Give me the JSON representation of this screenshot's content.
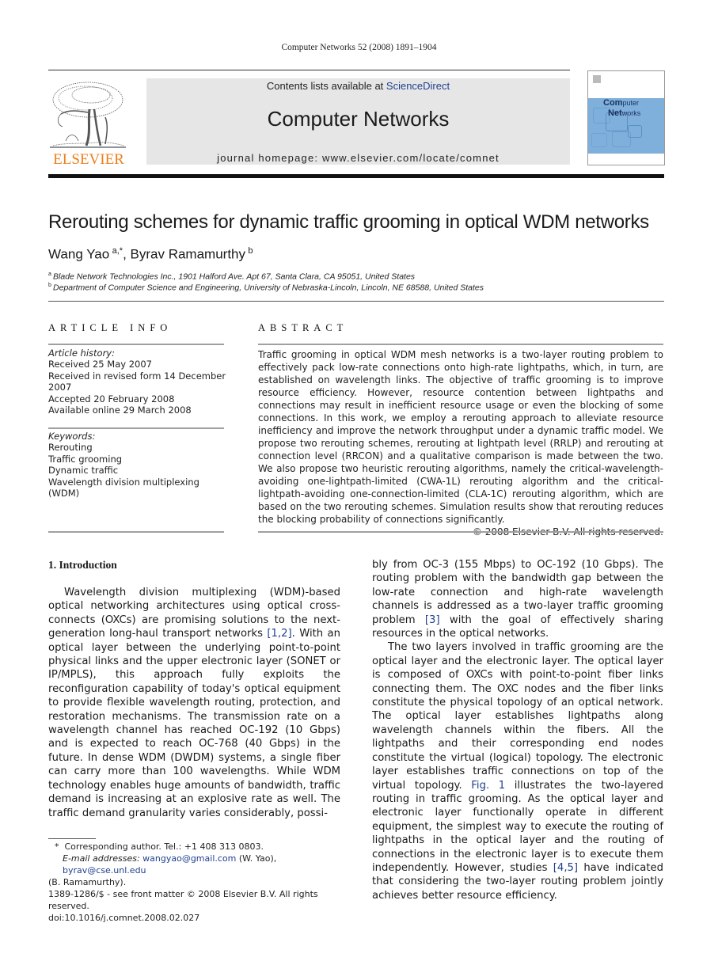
{
  "header": {
    "running_head": "Computer Networks 52 (2008) 1891–1904",
    "contents_prefix": "Contents lists available at ",
    "contents_link": "ScienceDirect",
    "journal_name": "Computer Networks",
    "homepage": "journal homepage: www.elsevier.com/locate/comnet",
    "publisher": "ELSEVIER",
    "cover_title_1a": "Com",
    "cover_title_1b": "puter",
    "cover_title_2a": "Net",
    "cover_title_2b": "works",
    "colors": {
      "publisher_orange": "#f07d19",
      "link_blue": "#1f3f8f",
      "banner_gray": "#e6e6e6",
      "cover_blue": "#7fb0dc"
    }
  },
  "article": {
    "title": "Rerouting schemes for dynamic traffic grooming in optical WDM networks",
    "authors": [
      {
        "name": "Wang Yao",
        "sup": "a,*"
      },
      {
        "name": "Byrav Ramamurthy",
        "sup": "b"
      }
    ],
    "author_sep": ", ",
    "affiliations": [
      {
        "mark": "a",
        "text": "Blade Network Technologies Inc., 1901 Halford Ave. Apt 67, Santa Clara, CA 95051, United States"
      },
      {
        "mark": "b",
        "text": "Department of Computer Science and Engineering, University of Nebraska-Lincoln, Lincoln, NE 68588, United States"
      }
    ]
  },
  "article_info": {
    "heading": "ARTICLE INFO",
    "history_label": "Article history:",
    "history": [
      "Received 25 May 2007",
      "Received in revised form 14 December 2007",
      "Accepted 20 February 2008",
      "Available online 29 March 2008"
    ],
    "keywords_label": "Keywords:",
    "keywords": [
      "Rerouting",
      "Traffic grooming",
      "Dynamic traffic",
      "Wavelength division multiplexing (WDM)"
    ]
  },
  "abstract": {
    "heading": "ABSTRACT",
    "text": "Traffic grooming in optical WDM mesh networks is a two-layer routing problem to effectively pack low-rate connections onto high-rate lightpaths, which, in turn, are established on wavelength links. The objective of traffic grooming is to improve resource efficiency. However, resource contention between lightpaths and connections may result in inefficient resource usage or even the blocking of some connections. In this work, we employ a rerouting approach to alleviate resource inefficiency and improve the network throughput under a dynamic traffic model. We propose two rerouting schemes, rerouting at lightpath level (RRLP) and rerouting at connection level (RRCON) and a qualitative comparison is made between the two. We also propose two heuristic rerouting algorithms, namely the critical-wavelength-avoiding one-lightpath-limited (CWA-1L) rerouting algorithm and the critical-lightpath-avoiding one-connection-limited (CLA-1C) rerouting algorithm, which are based on the two rerouting schemes. Simulation results show that rerouting reduces the blocking probability of connections significantly.",
    "copyright": "© 2008 Elsevier B.V. All rights reserved."
  },
  "intro": {
    "heading": "1.  Introduction",
    "p1_a": "Wavelength division multiplexing (WDM)-based optical networking architectures using optical cross-connects (OXCs) are promising solutions to the next-generation long-haul transport networks ",
    "p1_ref1": "[1,2]",
    "p1_b": ". With an optical layer between the underlying point-to-point physical links and the upper electronic layer (SONET or IP/MPLS), this approach fully exploits the reconfiguration capability of today's optical equipment to provide flexible wavelength routing, protection, and restoration mechanisms. The transmission rate on a wavelength channel has reached OC-192 (10 Gbps) and is expected to reach OC-768 (40 Gbps) in the future. In dense WDM (DWDM) systems, a single fiber can carry more than 100 wavelengths. While WDM technology enables huge amounts of bandwidth, traffic demand is increasing at an explosive rate as well. The traffic demand granularity varies considerably, possi-",
    "p1_c": "bly from OC-3 (155 Mbps) to OC-192 (10 Gbps). The routing problem with the bandwidth gap between the low-rate connection and high-rate wavelength channels is addressed as a two-layer traffic grooming problem ",
    "p1_ref2": "[3]",
    "p1_d": " with the goal of effectively sharing resources in the optical networks.",
    "p2_a": "The two layers involved in traffic grooming are the optical layer and the electronic layer. The optical layer is composed of OXCs with point-to-point fiber links connecting them. The OXC nodes and the fiber links constitute the physical topology of an optical network. The optical layer establishes lightpaths along wavelength channels within the fibers. All the lightpaths and their corresponding end nodes constitute the virtual (logical) topology. The electronic layer establishes traffic connections on top of the virtual topology. ",
    "p2_ref1": "Fig. 1",
    "p2_b": " illustrates the two-layered routing in traffic grooming. As the optical layer and electronic layer functionally operate in different equipment, the simplest way to execute the routing of lightpaths in the optical layer and the routing of connections in the electronic layer is to execute them independently. However, studies ",
    "p2_ref2": "[4,5]",
    "p2_c": " have indicated that considering the two-layer routing problem jointly achieves better resource efficiency."
  },
  "footnotes": {
    "mark": "*",
    "corresponding": "Corresponding author. Tel.: +1 408 313 0803.",
    "email_label": "E-mail addresses:",
    "email1": "wangyao@gmail.com",
    "email1_owner": " (W. Yao), ",
    "email2": "byrav@cse.unl.edu",
    "email2_owner": "(B. Ramamurthy).",
    "front_matter": "1389-1286/$ - see front matter © 2008 Elsevier B.V. All rights reserved.",
    "doi": "doi:10.1016/j.comnet.2008.02.027"
  }
}
